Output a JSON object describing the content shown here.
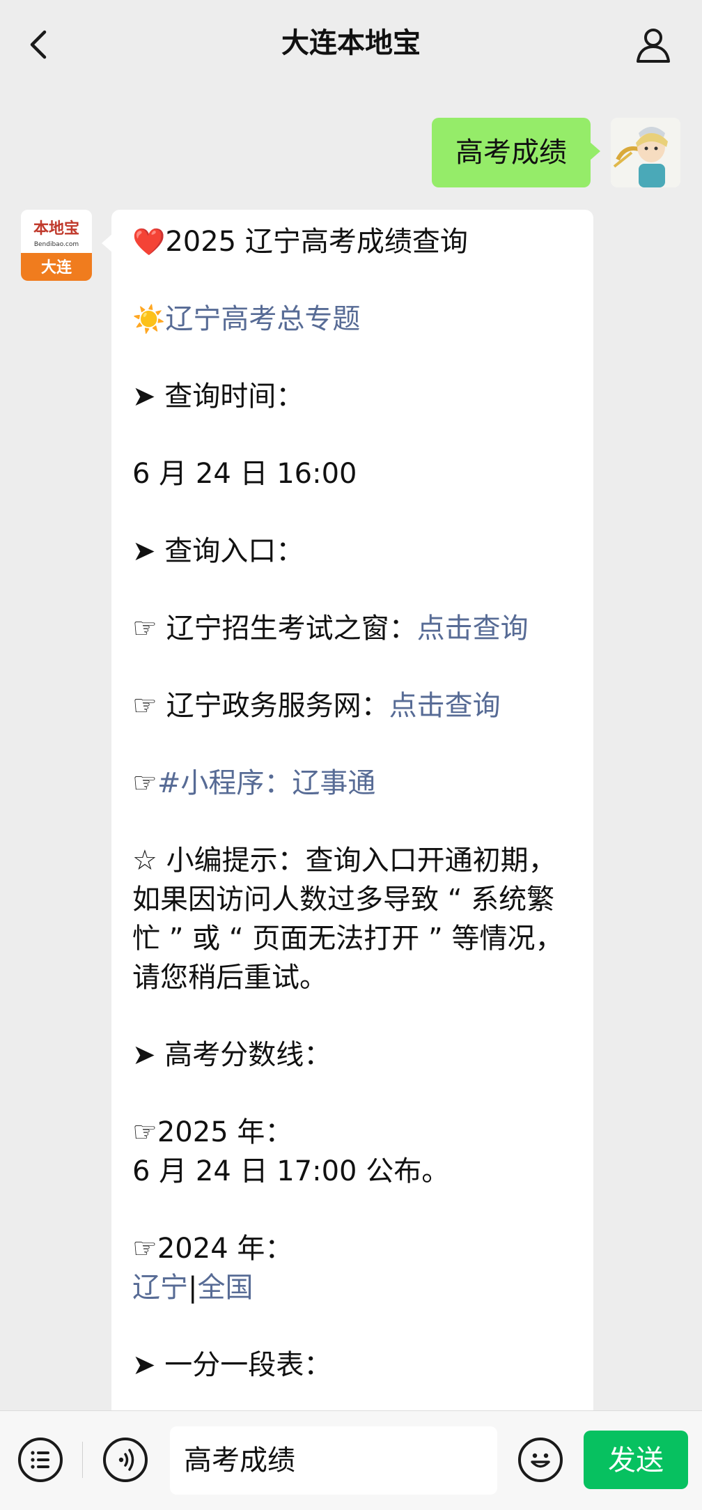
{
  "header": {
    "title": "大连本地宝"
  },
  "outgoing": {
    "text": "高考成绩"
  },
  "incoming": {
    "avatar_brand": "本地宝",
    "avatar_site": "Bendibao.com",
    "avatar_city": "大连",
    "lines": {
      "l1": "2025 辽宁高考成绩查询",
      "l1_emoji": "❤️",
      "l2": "辽宁高考总专题",
      "l2_emoji": "☀️",
      "l3": "➤ 查询时间：",
      "l4": "6 月 24 日 16:00",
      "l5": "➤ 查询入口：",
      "l6_prefix": "☞ 辽宁招生考试之窗：",
      "l6_link": "点击查询",
      "l7_prefix": "☞ 辽宁政务服务网：",
      "l7_link": "点击查询",
      "l8_prefix": "☞",
      "l8_link": "#小程序：辽事通",
      "l9": "☆ 小编提示：查询入口开通初期，如果因访问人数过多导致 “ 系统繁忙 ” 或 “ 页面无法打开 ” 等情况，请您稍后重试。",
      "l10": "➤ 高考分数线：",
      "l11": "☞2025 年：",
      "l12": "6 月 24 日 17:00 公布。",
      "l13": "☞2024 年：",
      "l14_link1": "辽宁",
      "l14_sep": "|",
      "l14_link2": "全国",
      "l15": "➤ 一分一段表："
    }
  },
  "input_bar": {
    "input_value": "高考成绩",
    "send_label": "发送"
  },
  "colors": {
    "background": "#ededed",
    "outgoing_bubble": "#95ec69",
    "link": "#576b95",
    "send_button": "#07c160"
  },
  "icons": [
    "back-icon",
    "profile-icon",
    "menu-list-icon",
    "voice-icon",
    "emoji-icon"
  ]
}
